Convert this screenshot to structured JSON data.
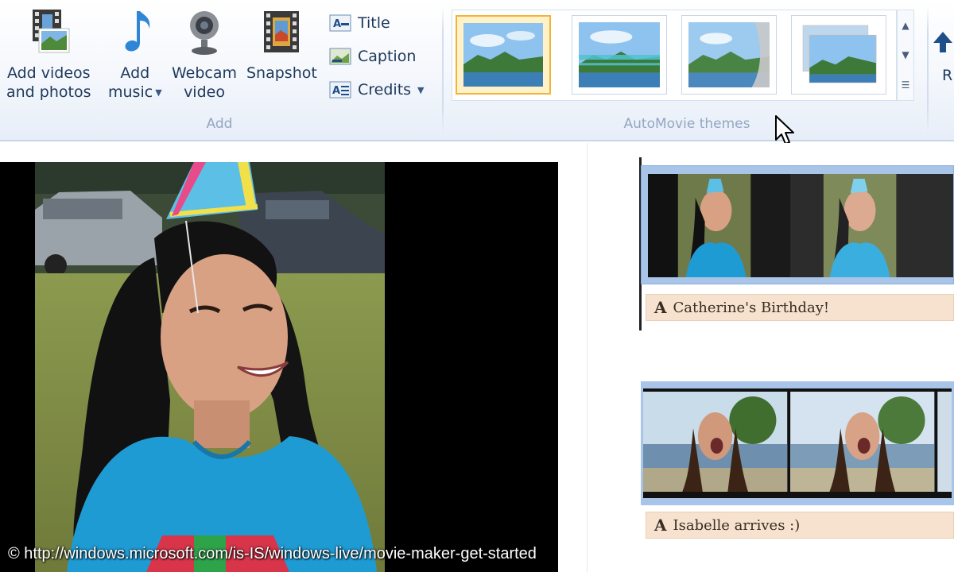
{
  "ribbon": {
    "add_group": {
      "label": "Add",
      "add_videos": {
        "line1": "Add videos",
        "line2": "and photos",
        "icon": "film-photo-icon"
      },
      "add_music": {
        "line1": "Add",
        "line2": "music",
        "icon": "music-note-icon"
      },
      "webcam": {
        "line1": "Webcam",
        "line2": "video",
        "icon": "webcam-icon"
      },
      "snapshot": {
        "line1": "Snapshot",
        "icon": "snapshot-icon"
      },
      "title": {
        "label": "Title",
        "icon": "title-icon"
      },
      "caption": {
        "label": "Caption",
        "icon": "caption-icon"
      },
      "credits": {
        "label": "Credits",
        "icon": "credits-icon"
      }
    },
    "themes_group": {
      "label": "AutoMovie themes",
      "selected_index": 0,
      "count_visible": 4
    },
    "partial_right_label": "R"
  },
  "storyboard": {
    "clips": [
      {
        "caption": "Catherine's Birthday!"
      },
      {
        "caption": "Isabelle arrives :)"
      }
    ]
  },
  "credit_text": "© http://windows.microsoft.com/is-IS/windows-live/movie-maker-get-started",
  "colors": {
    "ribbon_text": "#1e395b",
    "group_label": "#93a6c2",
    "selected_theme_border": "#f0b43a",
    "clip_bg": "#a8c4e8",
    "caption_bg": "#f7e2cf"
  }
}
